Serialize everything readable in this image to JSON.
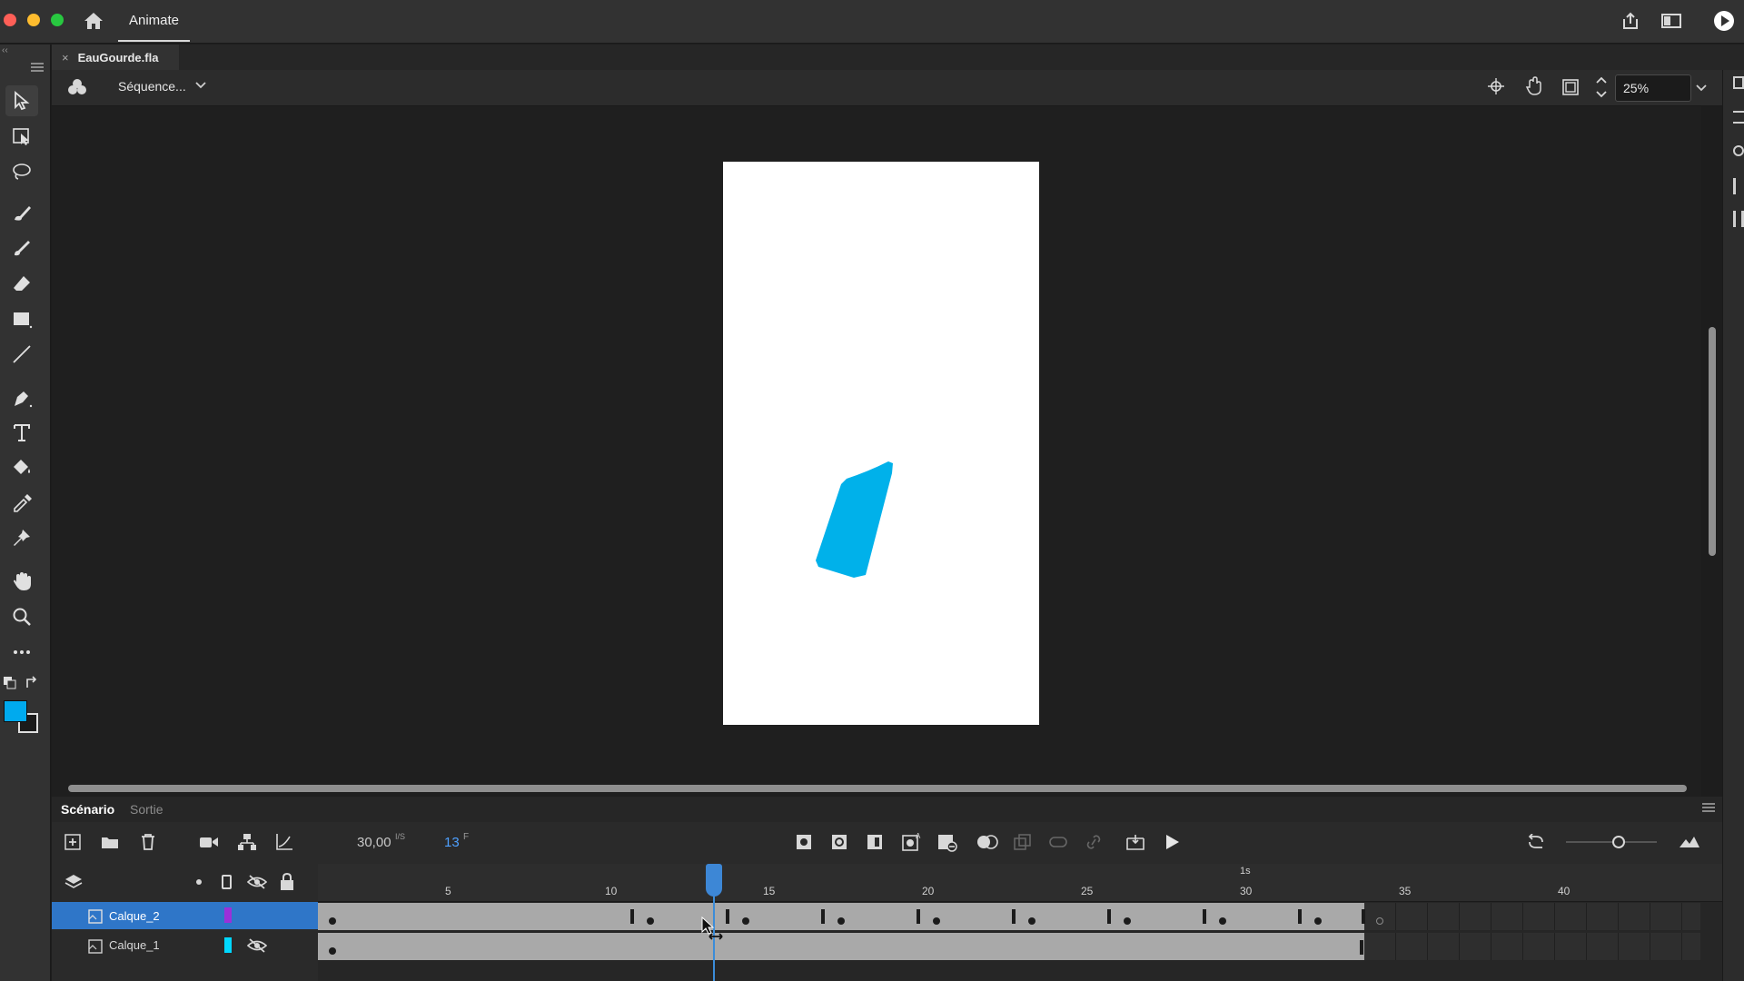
{
  "app": {
    "name": "Animate"
  },
  "document": {
    "tab_label": "EauGourde.fla"
  },
  "editbar": {
    "scene_label": "Séquence...",
    "zoom": "25%"
  },
  "timeline": {
    "tabs": [
      "Scénario",
      "Sortie"
    ],
    "fps_value": "30,00",
    "fps_unit": "I/S",
    "current_frame": "13",
    "frame_unit": "F",
    "ruler_numbers": [
      "5",
      "10",
      "15",
      "20",
      "25",
      "30",
      "35",
      "40"
    ],
    "seconds_marker": "1s",
    "layers": [
      {
        "name": "Calque_2",
        "color": "#9b30d9",
        "selected": true
      },
      {
        "name": "Calque_1",
        "color": "#00d8ff",
        "selected": false
      }
    ]
  },
  "colors": {
    "fill": "#00aaee",
    "stroke": "#1b1b1b",
    "accent": "#3d87d6",
    "shape": "#00b1ea"
  },
  "icons": [
    "home-icon",
    "share-icon",
    "workspace-icon",
    "play-circle-icon"
  ]
}
